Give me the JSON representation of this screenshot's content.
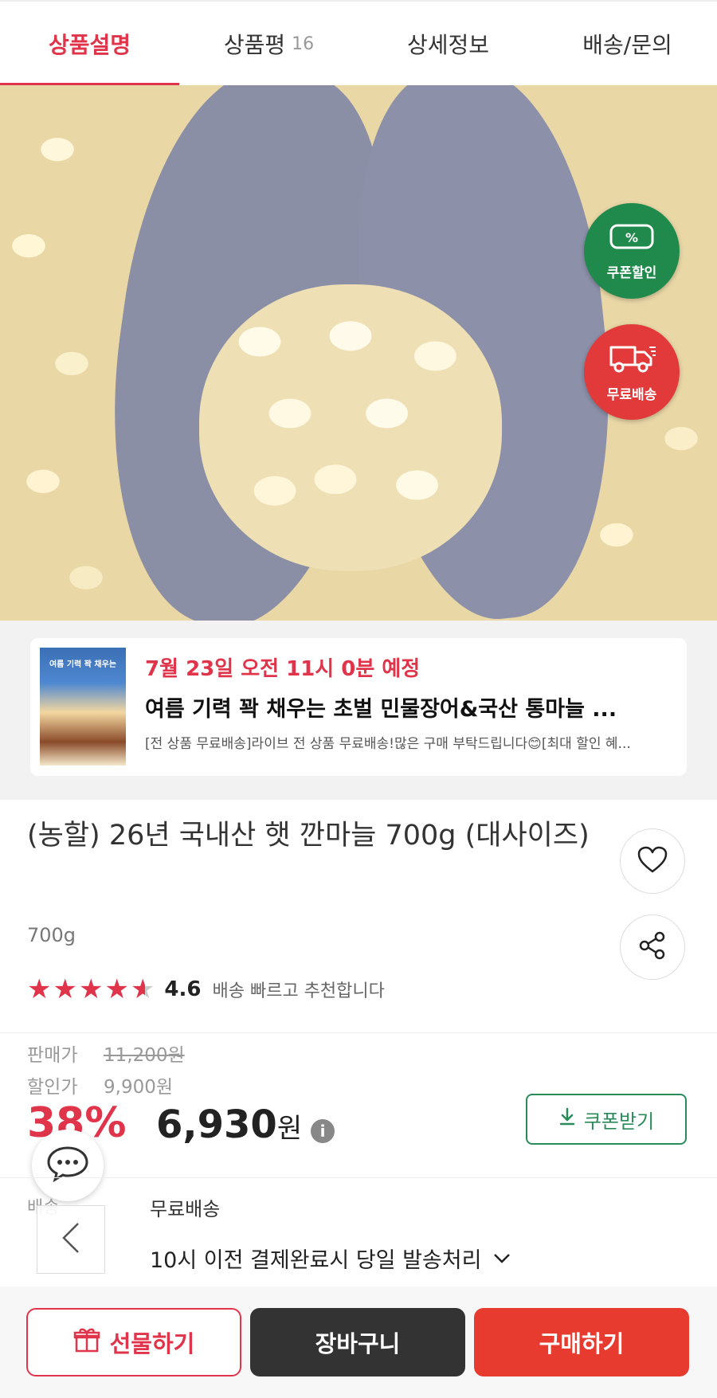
{
  "tabs": [
    {
      "label": "상품설명",
      "active": true
    },
    {
      "label": "상품평",
      "count": "16"
    },
    {
      "label": "상세정보"
    },
    {
      "label": "배송/문의"
    }
  ],
  "hero": {
    "badges": [
      {
        "label": "쿠폰할인",
        "icon": "coupon-percent-icon",
        "color": "#1f8a4c"
      },
      {
        "label": "무료배송",
        "icon": "delivery-truck-icon",
        "color": "#e23a3a"
      }
    ]
  },
  "live": {
    "thumb_text": "여름 기력 꽉 채우는",
    "date": "7월 23일 오전 11시 0분 예정",
    "title": "여름 기력 꽉 채우는 초벌 민물장어&국산 통마늘 ...",
    "desc": "[전 상품 무료배송]라이브 전 상품 무료배송!많은 구매 부탁드립니다😊[최대 할인 혜..."
  },
  "product": {
    "title": "(농할) 26년 국내산 햇 깐마늘 700g (대사이즈)",
    "option": "700g",
    "rating": "4.6",
    "review_summary": "배송 빠르고 추천합니다"
  },
  "price": {
    "sale_label": "판매가",
    "sale_value": "11,200원",
    "discount_label": "할인가",
    "discount_value": "9,900원",
    "discount_pct": "38%",
    "final_value": "6,930",
    "final_unit": "원",
    "coupon_button": "쿠폰받기"
  },
  "shipping": {
    "label": "배송",
    "value": "무료배송",
    "note": "10시 이전 결제완료시 당일 발송처리"
  },
  "bottom": {
    "gift": "선물하기",
    "cart": "장바구니",
    "buy": "구매하기"
  },
  "colors": {
    "accent": "#e0344a",
    "coupon_green": "#1f8a4c",
    "buy_red": "#e83b2f",
    "cart_dark": "#333333"
  }
}
